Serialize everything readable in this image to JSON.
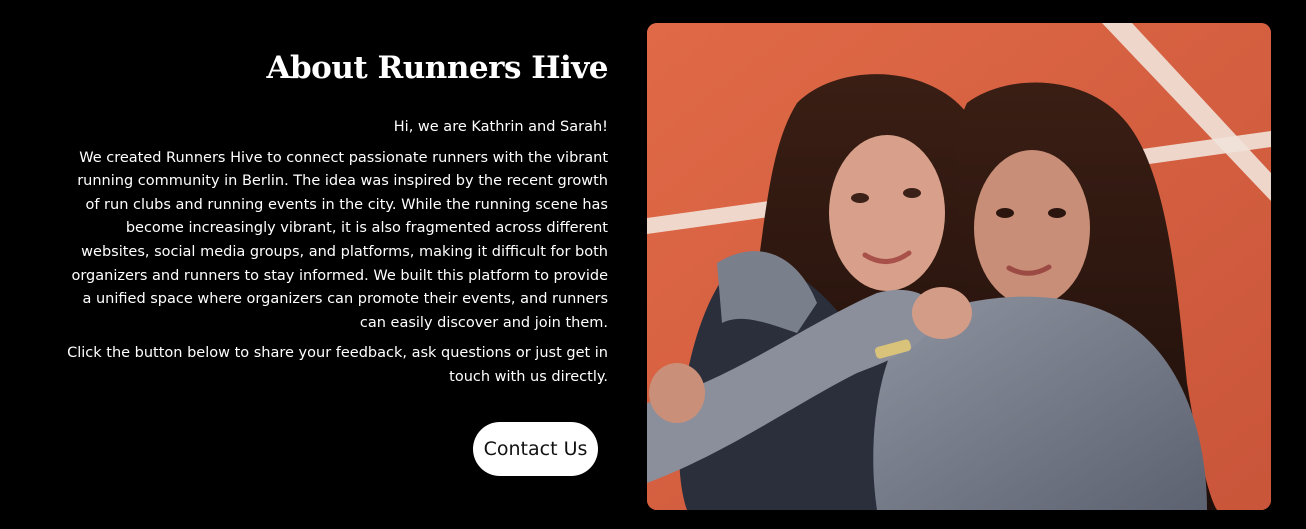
{
  "about": {
    "heading": "About Runners Hive",
    "greeting": "Hi, we are Kathrin and Sarah!",
    "story": "We created Runners Hive to connect passionate runners with the vibrant running community in Berlin. The idea was inspired by the recent growth of run clubs and running events in the city. While the running scene has become increasingly vibrant, it is also fragmented across different websites, social media groups, and platforms, making it difficult for both organizers and runners to stay informed. We built this platform to provide a unified space where organizers can promote their events, and runners can easily discover and join them.",
    "cta_text": "Click the button below to share your feedback, ask questions or just get in touch with us directly.",
    "contact_button": "Contact Us"
  },
  "photo": {
    "alt": "",
    "track_color": "#d9603e",
    "lane_line_color": "#f1e3da"
  },
  "colors": {
    "background": "#000000",
    "text": "#ffffff",
    "button_bg": "#ffffff",
    "button_text": "#111111"
  }
}
